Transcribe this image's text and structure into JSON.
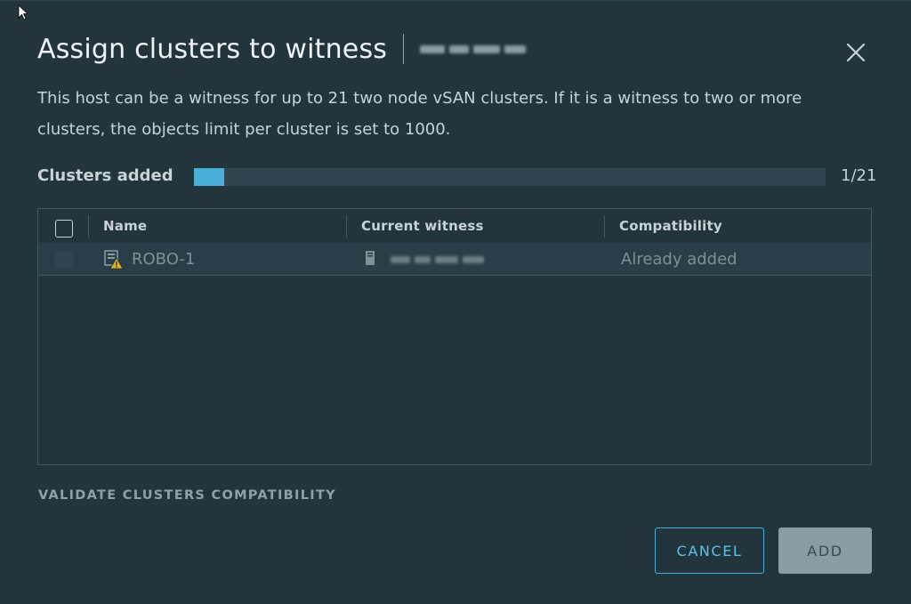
{
  "dialog": {
    "title": "Assign clusters to witness",
    "description": "This host can be a witness for up to 21 two node vSAN clusters. If it is a witness to two or more clusters, the objects limit per cluster is set to 1000."
  },
  "progress": {
    "label": "Clusters added",
    "count_text": "1/21",
    "fraction": 0.0476,
    "fill_color": "#49afd9"
  },
  "grid": {
    "columns": [
      "Name",
      "Current witness",
      "Compatibility"
    ],
    "rows": [
      {
        "name": "ROBO-1",
        "compatibility": "Already added",
        "name_icon": "cluster-warning-icon",
        "witness_icon": "host-icon"
      }
    ]
  },
  "actions": {
    "validate": "VALIDATE CLUSTERS COMPATIBILITY",
    "cancel": "CANCEL",
    "add": "ADD"
  },
  "colors": {
    "accent": "#49afd9",
    "background": "#22343c"
  }
}
